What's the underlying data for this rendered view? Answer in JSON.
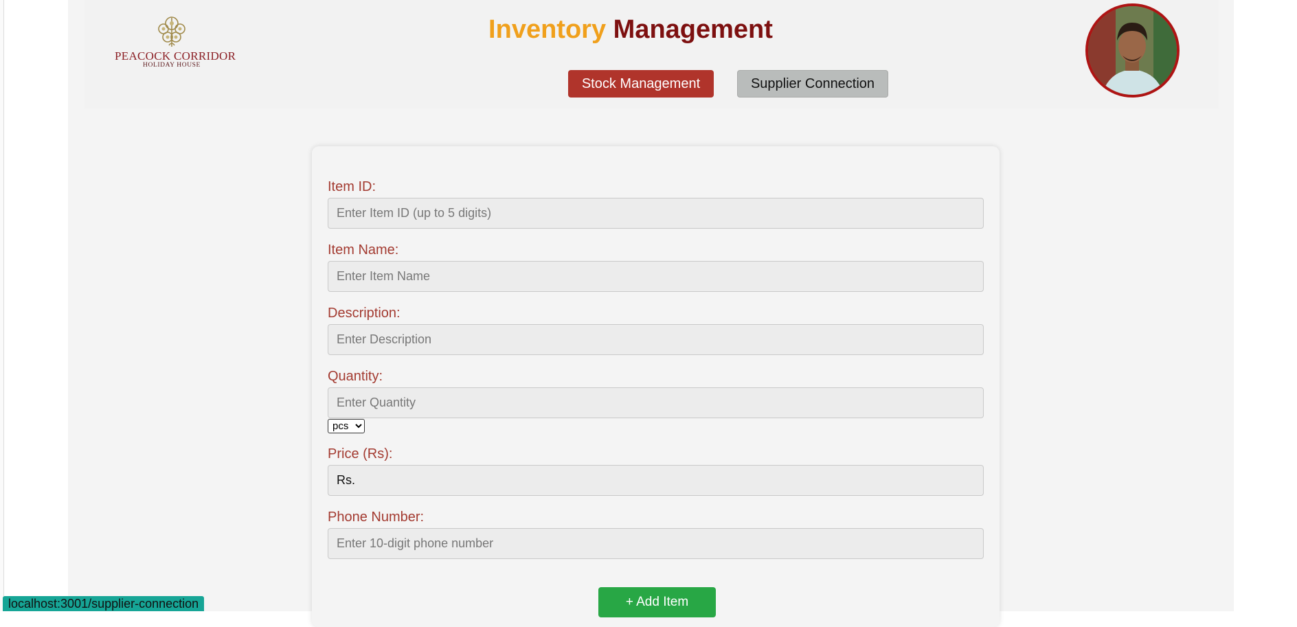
{
  "brand": {
    "logo_name": "PEACOCK CORRIDOR",
    "logo_sub": "HOLIDAY HOUSE"
  },
  "header": {
    "title_part1": "Inventory",
    "title_part2": "Management",
    "tabs": [
      {
        "label": "Stock Management",
        "active": true
      },
      {
        "label": "Supplier Connection",
        "active": false
      }
    ]
  },
  "form": {
    "item_id": {
      "label": "Item ID:",
      "placeholder": "Enter Item ID (up to 5 digits)",
      "value": ""
    },
    "item_name": {
      "label": "Item Name:",
      "placeholder": "Enter Item Name",
      "value": ""
    },
    "description": {
      "label": "Description:",
      "placeholder": "Enter Description",
      "value": ""
    },
    "quantity": {
      "label": "Quantity:",
      "placeholder": "Enter Quantity",
      "value": "",
      "unit": "pcs"
    },
    "price": {
      "label": "Price (Rs):",
      "value": "Rs."
    },
    "phone": {
      "label": "Phone Number:",
      "placeholder": "Enter 10-digit phone number",
      "value": ""
    },
    "submit_label": "+ Add Item"
  },
  "status_bar": {
    "url": "localhost:3001/supplier-connection"
  },
  "colors": {
    "title_accent": "#f0a01c",
    "title_dark": "#7d1010",
    "primary_tab": "#b0342b",
    "secondary_tab": "#b9bcbb",
    "label": "#a33a30",
    "add_button": "#28a745",
    "avatar_border": "#ae1414"
  },
  "icons": [
    "peacock-logo-icon",
    "chevron-down-icon"
  ]
}
